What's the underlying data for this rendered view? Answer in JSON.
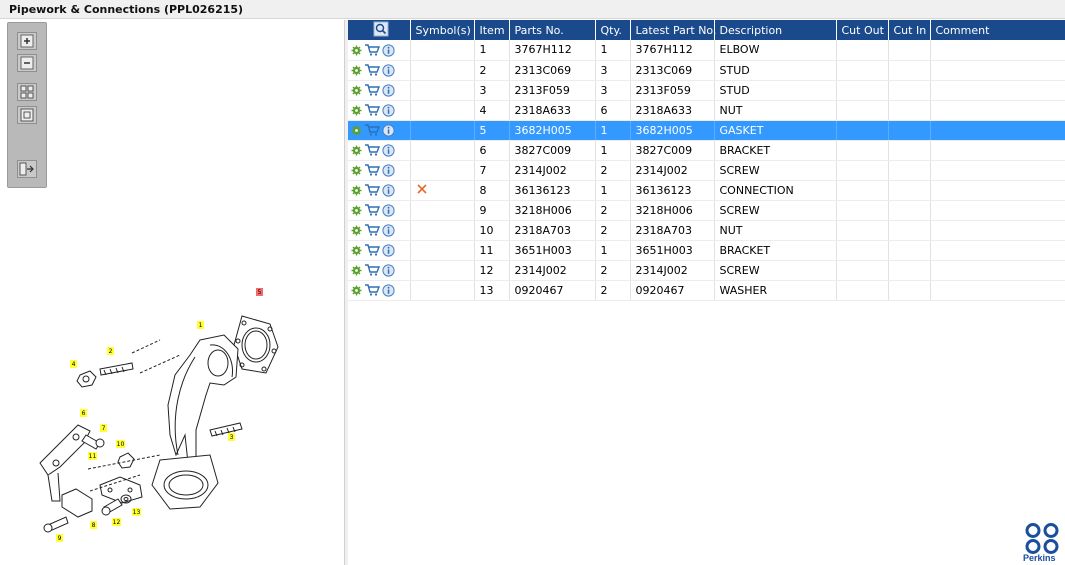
{
  "window": {
    "title": "Pipework & Connections (PPL026215)"
  },
  "toolbar": {
    "buttons": [
      {
        "name": "zoom-in-icon"
      },
      {
        "name": "zoom-out-icon"
      },
      {
        "name": "fit-all-icon"
      },
      {
        "name": "actual-size-icon"
      },
      {
        "name": "export-icon"
      }
    ]
  },
  "diagram": {
    "callouts": [
      "1",
      "2",
      "3",
      "4",
      "5",
      "6",
      "7",
      "8",
      "9",
      "10",
      "11",
      "12",
      "13"
    ]
  },
  "table": {
    "headers": {
      "icons": "search-icon",
      "symbols": "Symbol(s)",
      "item": "Item",
      "part_no": "Parts No.",
      "qty": "Qty.",
      "latest": "Latest Part No.",
      "description": "Description",
      "cut_out": "Cut Out",
      "cut_in": "Cut In",
      "comment": "Comment"
    },
    "rows": [
      {
        "item": "1",
        "part_no": "3767H112",
        "qty": "1",
        "latest": "3767H112",
        "description": "ELBOW",
        "symbol": ""
      },
      {
        "item": "2",
        "part_no": "2313C069",
        "qty": "3",
        "latest": "2313C069",
        "description": "STUD",
        "symbol": ""
      },
      {
        "item": "3",
        "part_no": "2313F059",
        "qty": "3",
        "latest": "2313F059",
        "description": "STUD",
        "symbol": ""
      },
      {
        "item": "4",
        "part_no": "2318A633",
        "qty": "6",
        "latest": "2318A633",
        "description": "NUT",
        "symbol": ""
      },
      {
        "item": "5",
        "part_no": "3682H005",
        "qty": "1",
        "latest": "3682H005",
        "description": "GASKET",
        "symbol": "",
        "selected": true
      },
      {
        "item": "6",
        "part_no": "3827C009",
        "qty": "1",
        "latest": "3827C009",
        "description": "BRACKET",
        "symbol": ""
      },
      {
        "item": "7",
        "part_no": "2314J002",
        "qty": "2",
        "latest": "2314J002",
        "description": "SCREW",
        "symbol": ""
      },
      {
        "item": "8",
        "part_no": "36136123",
        "qty": "1",
        "latest": "36136123",
        "description": "CONNECTION",
        "symbol": "x-mark-icon"
      },
      {
        "item": "9",
        "part_no": "3218H006",
        "qty": "2",
        "latest": "3218H006",
        "description": "SCREW",
        "symbol": ""
      },
      {
        "item": "10",
        "part_no": "2318A703",
        "qty": "2",
        "latest": "2318A703",
        "description": "NUT",
        "symbol": ""
      },
      {
        "item": "11",
        "part_no": "3651H003",
        "qty": "1",
        "latest": "3651H003",
        "description": "BRACKET",
        "symbol": ""
      },
      {
        "item": "12",
        "part_no": "2314J002",
        "qty": "2",
        "latest": "2314J002",
        "description": "SCREW",
        "symbol": ""
      },
      {
        "item": "13",
        "part_no": "0920467",
        "qty": "2",
        "latest": "0920467",
        "description": "WASHER",
        "symbol": ""
      }
    ]
  },
  "brand": {
    "name": "Perkins",
    "color": "#1a4f9c"
  },
  "colors": {
    "header": "#1b4a8c",
    "selected": "#3399ff",
    "gear": "#5aa02c",
    "cart": "#2f6fb6",
    "callout": "#ffff33",
    "callout_selected": "#f26c6c",
    "x_mark": "#e8692a"
  }
}
